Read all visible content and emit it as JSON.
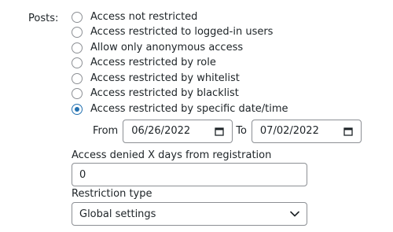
{
  "posts_label": "Posts:",
  "options": [
    {
      "label": "Access not restricted",
      "checked": false
    },
    {
      "label": "Access restricted to logged-in users",
      "checked": false
    },
    {
      "label": "Allow only anonymous access",
      "checked": false
    },
    {
      "label": "Access restricted by role",
      "checked": false
    },
    {
      "label": "Access restricted by whitelist",
      "checked": false
    },
    {
      "label": "Access restricted by blacklist",
      "checked": false
    },
    {
      "label": "Access restricted by specific date/time",
      "checked": true
    }
  ],
  "date_range": {
    "from_label": "From",
    "from_value": "06/26/2022",
    "to_label": "To",
    "to_value": "07/02/2022",
    "icon": "calendar-icon"
  },
  "access_denied": {
    "label": "Access denied X days from registration",
    "value": "0"
  },
  "restriction_type": {
    "label": "Restriction type",
    "selected": "Global settings",
    "icon": "chevron-down-icon"
  },
  "colors": {
    "accent": "#2271b1",
    "border": "#8c8f94",
    "text": "#1d2327"
  }
}
